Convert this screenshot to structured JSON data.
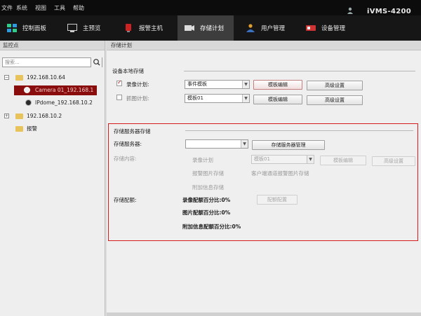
{
  "menu": [
    "文件",
    "系统",
    "视图",
    "工具",
    "帮助"
  ],
  "brand": "iVMS-4200",
  "tabs": [
    {
      "label": "控制面板",
      "icon": "control-panel-icon"
    },
    {
      "label": "主预览",
      "icon": "main-view-icon"
    },
    {
      "label": "报警主机",
      "icon": "alarm-host-icon"
    },
    {
      "label": "存储计划",
      "icon": "storage-schedule-icon",
      "active": true
    },
    {
      "label": "用户管理",
      "icon": "user-management-icon"
    },
    {
      "label": "设备管理",
      "icon": "device-management-icon"
    }
  ],
  "left": {
    "title": "监控点",
    "search_placeholder": "搜索...",
    "tree": [
      {
        "label": "192.168.10.64",
        "type": "group",
        "expanded": true
      },
      {
        "label": "Camera 01_192.168.1",
        "type": "camera",
        "selected": true
      },
      {
        "label": "IPdome_192.168.10.2",
        "type": "camera"
      },
      {
        "label": "192.168.10.2",
        "type": "group",
        "expanded": false
      },
      {
        "label": "报警",
        "type": "folder"
      }
    ]
  },
  "main": {
    "title": "存储计划",
    "local": {
      "section": "设备本地存储",
      "record_label": "录像计划:",
      "record_checked": true,
      "record_template": "事件模板",
      "record_edit": "模板编辑",
      "record_advanced": "高级设置",
      "capture_label": "抓图计划:",
      "capture_checked": false,
      "capture_template": "模板01",
      "capture_edit": "模板编辑",
      "capture_advanced": "高级设置"
    },
    "server": {
      "section": "存储服务器存储",
      "server_label": "存储服务器:",
      "server_value": "",
      "server_manage": "存储服务器管理",
      "content_label": "存储内容:",
      "record_plan": "录像计划",
      "record_template": "模板01",
      "edit": "模板编辑",
      "advanced": "高级设置",
      "alarm_pic": "报警图片存储",
      "alarm_pic_note": "客户端通道报警图片存储",
      "extra_info": "附加信息存储",
      "quota_label": "存储配额:",
      "record_quota": "录像配额百分比:0%",
      "pic_quota": "图片配额百分比:0%",
      "extra_quota": "附加信息配额百分比:0%",
      "quota_button": "配额配置"
    }
  }
}
